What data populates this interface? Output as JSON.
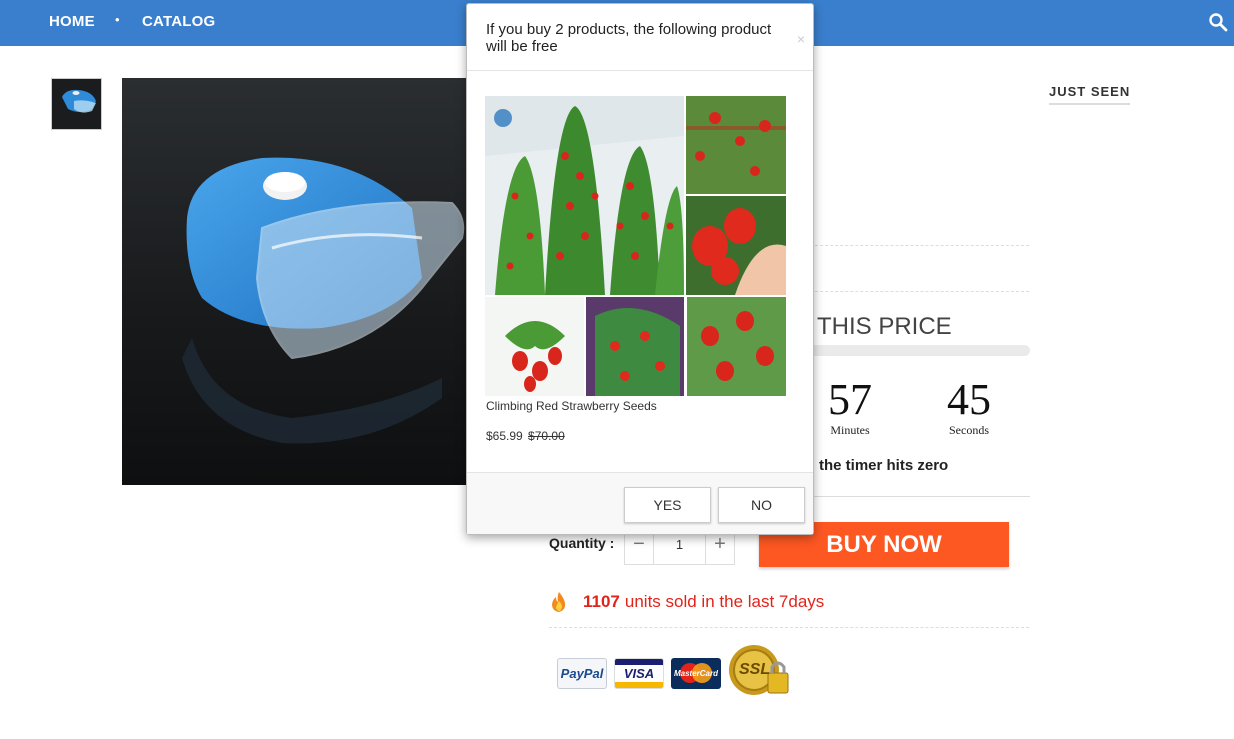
{
  "nav": {
    "home": "HOME",
    "catalog": "CATALOG",
    "separator": "•",
    "search_icon": "search-icon",
    "bg_color": "#3a7fcd"
  },
  "sidebar": {
    "just_seen": "JUST SEEN"
  },
  "product": {
    "price_heading": "THIS PRICE",
    "timer": {
      "minutes": "57",
      "minutes_label": "Minutes",
      "seconds": "45",
      "seconds_label": "Seconds"
    },
    "timer_note": "the timer hits zero",
    "quantity_label": "Quantity :",
    "quantity_minus": "−",
    "quantity_value": "1",
    "quantity_plus": "+",
    "buy_label": "BUY NOW",
    "buy_color": "#fd5722",
    "sold_count": "1107",
    "sold_text": "units sold in the last 7days",
    "sold_color": "#e2231a",
    "badges": {
      "paypal": "PayPal",
      "visa": "VISA",
      "mastercard": "MasterCard",
      "ssl": "SSL"
    }
  },
  "modal": {
    "title": "If you buy 2 products, the following product will be free",
    "close": "×",
    "product_name": "Climbing Red Strawberry Seeds",
    "price": "$65.99",
    "old_price": "$70.00",
    "yes": "YES",
    "no": "NO"
  }
}
